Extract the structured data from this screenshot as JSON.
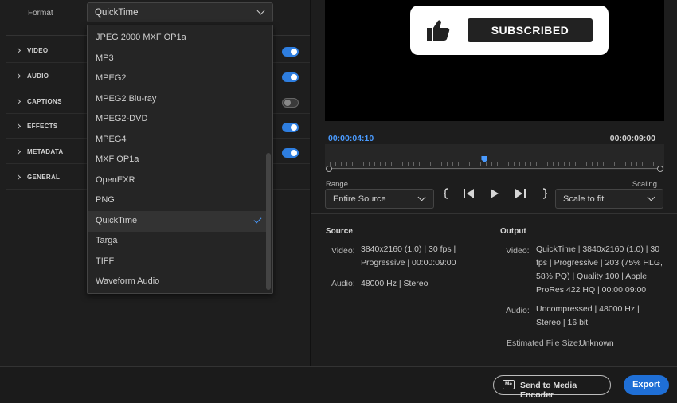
{
  "format": {
    "label": "Format",
    "value": "QuickTime"
  },
  "sections": [
    {
      "label": "VIDEO",
      "toggle": true
    },
    {
      "label": "AUDIO",
      "toggle": true
    },
    {
      "label": "CAPTIONS",
      "toggle": false
    },
    {
      "label": "EFFECTS",
      "toggle": true
    },
    {
      "label": "METADATA",
      "toggle": true
    },
    {
      "label": "GENERAL",
      "toggle": null
    }
  ],
  "dropdown": {
    "items": [
      "JPEG 2000 MXF OP1a",
      "MP3",
      "MPEG2",
      "MPEG2 Blu-ray",
      "MPEG2-DVD",
      "MPEG4",
      "MXF OP1a",
      "OpenEXR",
      "PNG",
      "QuickTime",
      "Targa",
      "TIFF",
      "Waveform Audio"
    ],
    "selected": "QuickTime"
  },
  "preview": {
    "subscribe_label": "SUBSCRIBED",
    "current_time": "00:00:04:10",
    "duration": "00:00:09:00",
    "range_label": "Range",
    "range_value": "Entire Source",
    "scaling_label": "Scaling",
    "scaling_value": "Scale to fit",
    "playhead_fraction": 0.47
  },
  "source": {
    "heading": "Source",
    "video_key": "Video:",
    "video_lines": [
      "3840x2160 (1.0)  |  30 fps  |",
      "Progressive  |  00:00:09:00"
    ],
    "audio_key": "Audio:",
    "audio_value": "48000 Hz  |  Stereo"
  },
  "output": {
    "heading": "Output",
    "video_key": "Video:",
    "video_lines": [
      "QuickTime  |  3840x2160 (1.0)  |  30",
      "fps  |  Progressive  |  203 (75% HLG,",
      "58% PQ)  |  Quality 100  |  Apple",
      "ProRes 422 HQ  |  00:00:09:00"
    ],
    "audio_key": "Audio:",
    "audio_lines": [
      "Uncompressed  |  48000 Hz  |",
      "Stereo  |  16 bit"
    ],
    "size_key": "Estimated File Size:",
    "size_value": "Unknown"
  },
  "footer": {
    "me_icon": "Me",
    "send_label": "Send to Media Encoder",
    "export_label": "Export"
  },
  "colors": {
    "accent": "#2e7ee0",
    "timecode": "#4a9bff",
    "export": "#1f6fd6"
  }
}
